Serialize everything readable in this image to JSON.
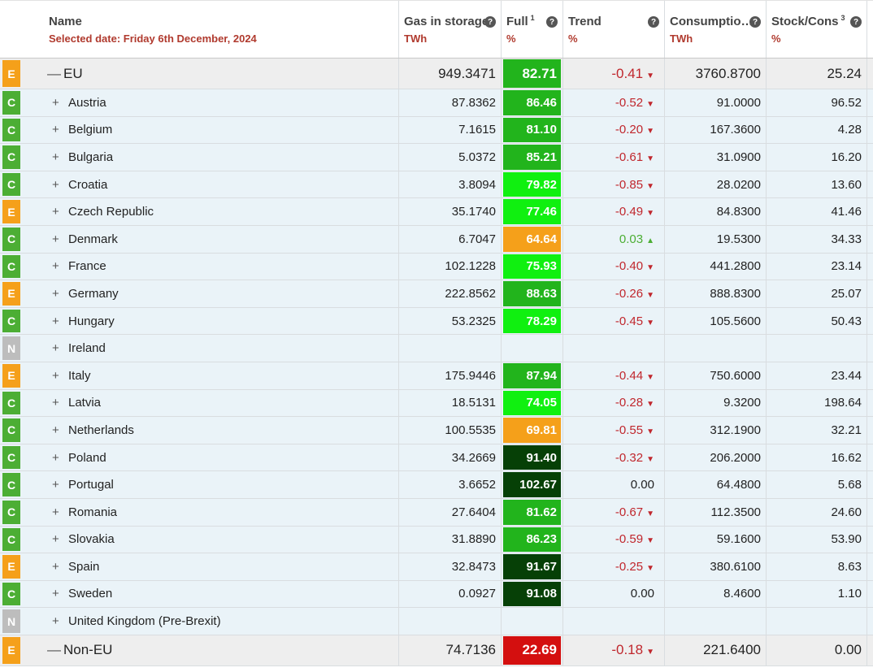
{
  "header": {
    "name_label": "Name",
    "selected_date": "Selected date: Friday 6th December, 2024",
    "gas_label": "Gas in storage",
    "gas_unit": "TWh",
    "full_label": "Full",
    "full_sup": "1",
    "full_unit": "%",
    "trend_label": "Trend",
    "trend_unit": "%",
    "cons_label": "Consumptio…",
    "cons_unit": "TWh",
    "stock_label": "Stock/Cons",
    "stock_sup": "3",
    "stock_unit": "%",
    "help_glyph": "?"
  },
  "icons": {
    "expand": "plus-icon",
    "collapse": "minus-icon",
    "trend_down": "caret-down-icon",
    "trend_up": "caret-up-icon",
    "help": "question-icon"
  },
  "colors": {
    "badge_E": "#f5a01a",
    "badge_C": "#4cae34",
    "badge_N": "#bdbdbd",
    "negative": "#c0272d",
    "positive": "#4cae34"
  },
  "rows": [
    {
      "badge": "E",
      "name": "EU",
      "group": true,
      "sign": "—",
      "gas": "949.3471",
      "full": "82.71",
      "full_color": "#22b41c",
      "trend": "-0.41",
      "dir": "down",
      "cons": "3760.8700",
      "stock": "25.24"
    },
    {
      "badge": "C",
      "name": "Austria",
      "sign": "+",
      "gas": "87.8362",
      "full": "86.46",
      "full_color": "#22b41c",
      "trend": "-0.52",
      "dir": "down",
      "cons": "91.0000",
      "stock": "96.52"
    },
    {
      "badge": "C",
      "name": "Belgium",
      "sign": "+",
      "gas": "7.1615",
      "full": "81.10",
      "full_color": "#22b41c",
      "trend": "-0.20",
      "dir": "down",
      "cons": "167.3600",
      "stock": "4.28"
    },
    {
      "badge": "C",
      "name": "Bulgaria",
      "sign": "+",
      "gas": "5.0372",
      "full": "85.21",
      "full_color": "#22b41c",
      "trend": "-0.61",
      "dir": "down",
      "cons": "31.0900",
      "stock": "16.20"
    },
    {
      "badge": "C",
      "name": "Croatia",
      "sign": "+",
      "gas": "3.8094",
      "full": "79.82",
      "full_color": "#10f010",
      "trend": "-0.85",
      "dir": "down",
      "cons": "28.0200",
      "stock": "13.60"
    },
    {
      "badge": "E",
      "name": "Czech Republic",
      "sign": "+",
      "gas": "35.1740",
      "full": "77.46",
      "full_color": "#10f010",
      "trend": "-0.49",
      "dir": "down",
      "cons": "84.8300",
      "stock": "41.46"
    },
    {
      "badge": "C",
      "name": "Denmark",
      "sign": "+",
      "gas": "6.7047",
      "full": "64.64",
      "full_color": "#f5a01a",
      "trend": "0.03",
      "dir": "up",
      "cons": "19.5300",
      "stock": "34.33"
    },
    {
      "badge": "C",
      "name": "France",
      "sign": "+",
      "gas": "102.1228",
      "full": "75.93",
      "full_color": "#10f010",
      "trend": "-0.40",
      "dir": "down",
      "cons": "441.2800",
      "stock": "23.14"
    },
    {
      "badge": "E",
      "name": "Germany",
      "sign": "+",
      "gas": "222.8562",
      "full": "88.63",
      "full_color": "#22b41c",
      "trend": "-0.26",
      "dir": "down",
      "cons": "888.8300",
      "stock": "25.07"
    },
    {
      "badge": "C",
      "name": "Hungary",
      "sign": "+",
      "gas": "53.2325",
      "full": "78.29",
      "full_color": "#10f010",
      "trend": "-0.45",
      "dir": "down",
      "cons": "105.5600",
      "stock": "50.43"
    },
    {
      "badge": "N",
      "name": "Ireland",
      "sign": "+",
      "gas": "",
      "full": "",
      "full_color": "",
      "trend": "",
      "dir": "",
      "cons": "",
      "stock": ""
    },
    {
      "badge": "E",
      "name": "Italy",
      "sign": "+",
      "gas": "175.9446",
      "full": "87.94",
      "full_color": "#22b41c",
      "trend": "-0.44",
      "dir": "down",
      "cons": "750.6000",
      "stock": "23.44"
    },
    {
      "badge": "C",
      "name": "Latvia",
      "sign": "+",
      "gas": "18.5131",
      "full": "74.05",
      "full_color": "#10f010",
      "trend": "-0.28",
      "dir": "down",
      "cons": "9.3200",
      "stock": "198.64"
    },
    {
      "badge": "C",
      "name": "Netherlands",
      "sign": "+",
      "gas": "100.5535",
      "full": "69.81",
      "full_color": "#f5a01a",
      "trend": "-0.55",
      "dir": "down",
      "cons": "312.1900",
      "stock": "32.21"
    },
    {
      "badge": "C",
      "name": "Poland",
      "sign": "+",
      "gas": "34.2669",
      "full": "91.40",
      "full_color": "#064006",
      "trend": "-0.32",
      "dir": "down",
      "cons": "206.2000",
      "stock": "16.62"
    },
    {
      "badge": "C",
      "name": "Portugal",
      "sign": "+",
      "gas": "3.6652",
      "full": "102.67",
      "full_color": "#064006",
      "trend": "0.00",
      "dir": "",
      "cons": "64.4800",
      "stock": "5.68"
    },
    {
      "badge": "C",
      "name": "Romania",
      "sign": "+",
      "gas": "27.6404",
      "full": "81.62",
      "full_color": "#22b41c",
      "trend": "-0.67",
      "dir": "down",
      "cons": "112.3500",
      "stock": "24.60"
    },
    {
      "badge": "C",
      "name": "Slovakia",
      "sign": "+",
      "gas": "31.8890",
      "full": "86.23",
      "full_color": "#22b41c",
      "trend": "-0.59",
      "dir": "down",
      "cons": "59.1600",
      "stock": "53.90"
    },
    {
      "badge": "E",
      "name": "Spain",
      "sign": "+",
      "gas": "32.8473",
      "full": "91.67",
      "full_color": "#064006",
      "trend": "-0.25",
      "dir": "down",
      "cons": "380.6100",
      "stock": "8.63"
    },
    {
      "badge": "C",
      "name": "Sweden",
      "sign": "+",
      "gas": "0.0927",
      "full": "91.08",
      "full_color": "#064006",
      "trend": "0.00",
      "dir": "",
      "cons": "8.4600",
      "stock": "1.10"
    },
    {
      "badge": "N",
      "name": "United Kingdom (Pre-Brexit)",
      "sign": "+",
      "gas": "",
      "full": "",
      "full_color": "",
      "trend": "",
      "dir": "",
      "cons": "",
      "stock": ""
    },
    {
      "badge": "E",
      "name": "Non-EU",
      "group": true,
      "sign": "—",
      "gas": "74.7136",
      "full": "22.69",
      "full_color": "#d40f0f",
      "trend": "-0.18",
      "dir": "down",
      "cons": "221.6400",
      "stock": "0.00"
    }
  ]
}
